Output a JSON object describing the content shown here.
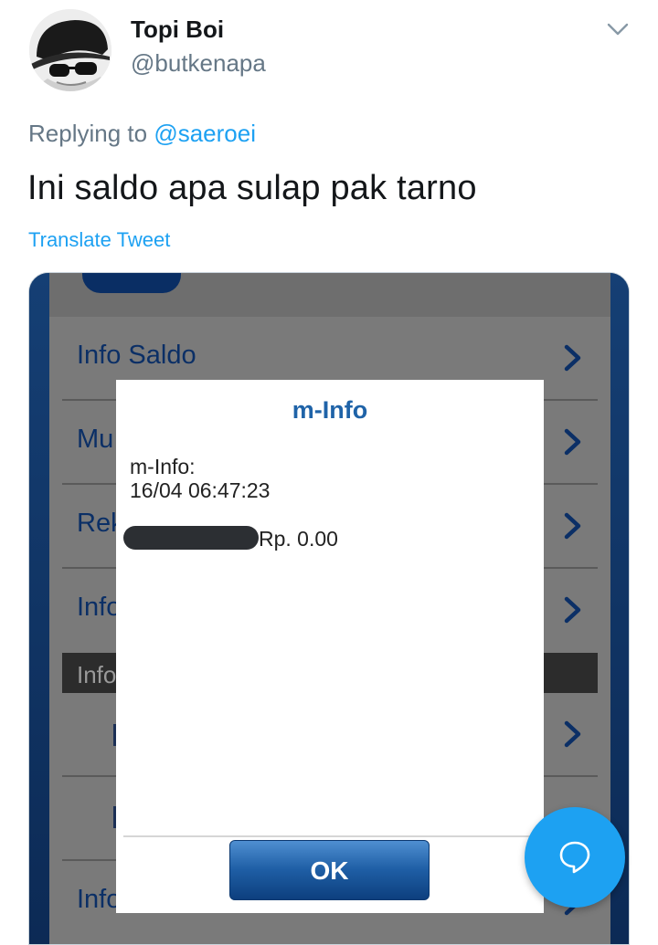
{
  "tweet": {
    "display_name": "Topi Boi",
    "handle": "@butkenapa",
    "replying_to_prefix": "Replying to",
    "replying_to_handle": "@saeroei",
    "text": "Ini saldo apa sulap pak tarno",
    "translate_label": "Translate Tweet"
  },
  "media": {
    "menu_items": [
      {
        "label": "Info Saldo"
      },
      {
        "label": "Mu"
      },
      {
        "label": "Rek"
      },
      {
        "label": "Info"
      }
    ],
    "section_label": "Info",
    "bottom_item_label": "Info",
    "dialog": {
      "title": "m-Info",
      "line1": "m-Info:",
      "line2": "16/04 06:47:23",
      "balance": "Rp. 0.00",
      "ok_label": "OK"
    }
  },
  "icons": {
    "menu_caret": "chevron-down-icon",
    "row_chevron": "chevron-right-icon",
    "fab": "compose-reply-icon"
  },
  "colors": {
    "accent": "#1da1f2",
    "secondary_text": "#657786",
    "dialog_title": "#1f63a8",
    "menu_text": "#0b2f66"
  }
}
